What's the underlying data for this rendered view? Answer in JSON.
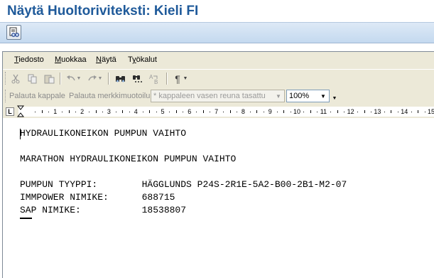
{
  "window": {
    "title": "Näytä Huoltoriviteksti: Kieli FI"
  },
  "menu": {
    "items": [
      {
        "label": "Tiedosto",
        "underline": "T"
      },
      {
        "label": "Muokkaa",
        "underline": "M"
      },
      {
        "label": "Näytä",
        "underline": "N"
      },
      {
        "label": "Työkalut",
        "underline": "y"
      }
    ]
  },
  "toolbar": {
    "icons": [
      "cut-icon",
      "copy-icon",
      "paste-icon",
      "undo-icon",
      "redo-icon",
      "find-icon",
      "find-next-icon",
      "replace-icon",
      "paragraph-mark-icon"
    ]
  },
  "format_bar": {
    "paragraph_label": "Palauta kappale",
    "char_format_label": "Palauta merkkimuotoilu",
    "style_value": "* kappaleen vasen reuna tasattu",
    "zoom_value": "100%"
  },
  "ruler": {
    "numbers": [
      "1",
      "2",
      "3",
      "4",
      "5",
      "6",
      "7",
      "8",
      "9",
      "10",
      "11",
      "12",
      "13",
      "14",
      "15"
    ]
  },
  "document": {
    "lines": [
      "HYDRAULIKONEIKON PUMPUN VAIHTO",
      "",
      "MARATHON HYDRAULIKONEIKON PUMPUN VAIHTO",
      "",
      "PUMPUN TYYPPI:        HÄGGLUNDS P24S-2R1E-5A2-B00-2B1-M2-07",
      "IMMPOWER NIMIKE:      688715",
      "SAP NIMIKE:           18538807"
    ]
  },
  "colors": {
    "title": "#1f5a9a",
    "app_toolbar": "#c4d9ef",
    "chrome": "#ece9d8"
  }
}
